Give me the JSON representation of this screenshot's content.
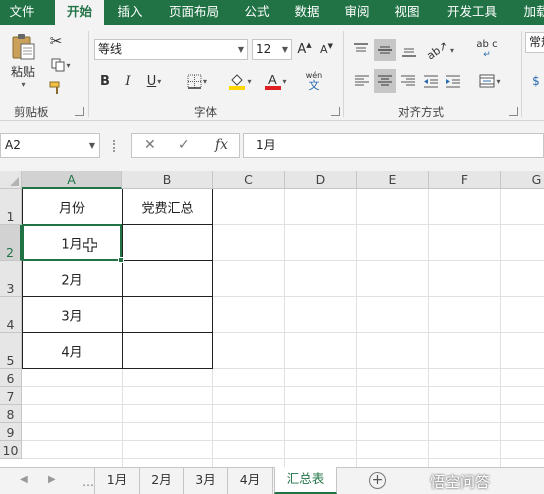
{
  "ribbon_tabs": [
    "文件",
    "开始",
    "插入",
    "页面布局",
    "公式",
    "数据",
    "审阅",
    "视图",
    "开发工具",
    "加载"
  ],
  "active_tab": "开始",
  "ribbon": {
    "clipboard": {
      "paste_label": "粘贴",
      "group_label": "剪贴板"
    },
    "font": {
      "font_name": "等线",
      "font_size": "12",
      "bold": "B",
      "italic": "I",
      "underline": "U",
      "grow": "A",
      "shrink": "A",
      "phonetic": "wén",
      "phonetic_glyph": "文",
      "group_label": "字体"
    },
    "alignment": {
      "group_label": "对齐方式",
      "wrap_icon": "ab c",
      "selected_alignment": "center-horizontal"
    },
    "number": {
      "format": "常规"
    }
  },
  "formula_bar": {
    "name_box": "A2",
    "fx_label": "fx",
    "cancel_label": "✕",
    "enter_label": "✓",
    "value": "1月"
  },
  "grid": {
    "columns": [
      "A",
      "B",
      "C",
      "D",
      "E",
      "F",
      "G"
    ],
    "rows": [
      "1",
      "2",
      "3",
      "4",
      "5",
      "6",
      "7",
      "8",
      "9",
      "10"
    ],
    "selected_column": "A",
    "selected_row": "2",
    "header_row": [
      "月份",
      "党费汇总"
    ],
    "data_rows": [
      [
        "1月",
        ""
      ],
      [
        "2月",
        ""
      ],
      [
        "3月",
        ""
      ],
      [
        "4月",
        ""
      ]
    ]
  },
  "sheets": {
    "tabs": [
      "1月",
      "2月",
      "3月",
      "4月",
      "汇总表"
    ],
    "active": "汇总表",
    "watermark": "悟空问答"
  },
  "colors": {
    "accent": "#217346",
    "ribbon_bg": "#f3f3f3",
    "font_color_bar": "#e02020",
    "fill_color_bar": "#ffd700"
  }
}
